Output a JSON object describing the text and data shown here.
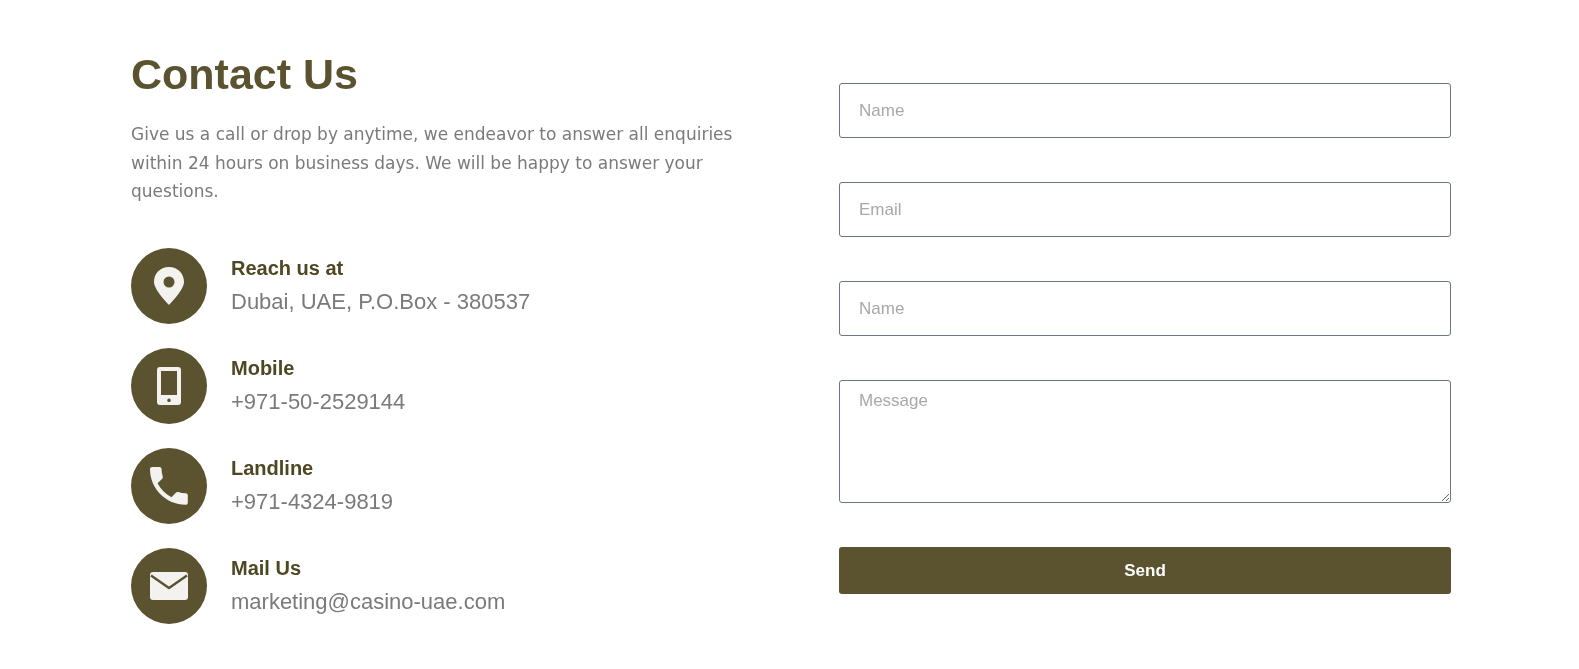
{
  "heading": "Contact Us",
  "intro": "Give us a call or drop by anytime, we endeavor to answer all enquiries within 24 hours on business days. We will be happy to answer your questions.",
  "contacts": [
    {
      "kind": "location",
      "label": "Reach us at",
      "value": "Dubai, UAE, P.O.Box - 380537"
    },
    {
      "kind": "mobile",
      "label": "Mobile",
      "value": "+971-50-2529144"
    },
    {
      "kind": "phone",
      "label": "Landline",
      "value": "+971-4324-9819"
    },
    {
      "kind": "mail",
      "label": "Mail Us",
      "value": "marketing@casino-uae.com"
    }
  ],
  "form": {
    "fields": [
      {
        "kind": "input",
        "placeholder": "Name"
      },
      {
        "kind": "input",
        "placeholder": "Email"
      },
      {
        "kind": "input",
        "placeholder": "Name"
      },
      {
        "kind": "textarea",
        "placeholder": "Message"
      }
    ],
    "submit": "Send"
  }
}
